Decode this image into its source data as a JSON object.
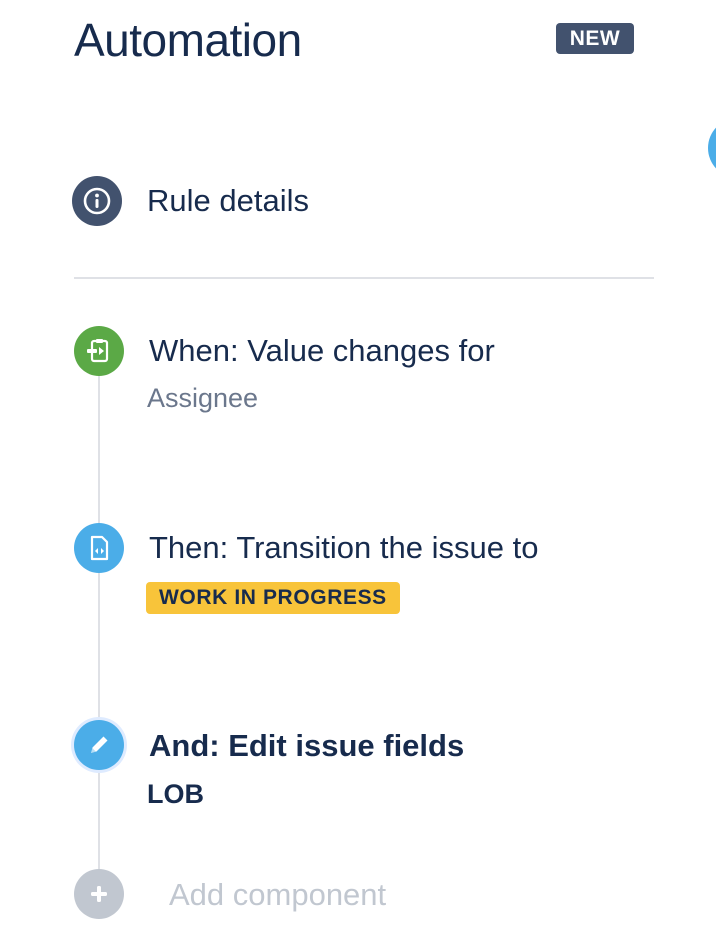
{
  "header": {
    "title": "Automation",
    "badge": "NEW"
  },
  "rule_details": {
    "label": "Rule details",
    "icon": "info-icon"
  },
  "steps": [
    {
      "title": "When: Value changes for",
      "subtitle": "Assignee",
      "icon": "trigger-icon",
      "color": "#5BA946"
    },
    {
      "title": "Then: Transition the issue to",
      "status": "WORK IN PROGRESS",
      "status_color": "#F8C43A",
      "icon": "transition-icon",
      "color": "#4BADE8"
    },
    {
      "title": "And: Edit issue fields",
      "subtitle": "LOB",
      "icon": "pencil-icon",
      "color": "#4BADE8",
      "selected": true
    }
  ],
  "add_component": {
    "label": "Add component",
    "icon": "plus-icon"
  },
  "colors": {
    "title": "#172B4D",
    "badge_bg": "#42526E",
    "trigger": "#5BA946",
    "action": "#4BADE8",
    "muted": "#C1C7D0"
  }
}
